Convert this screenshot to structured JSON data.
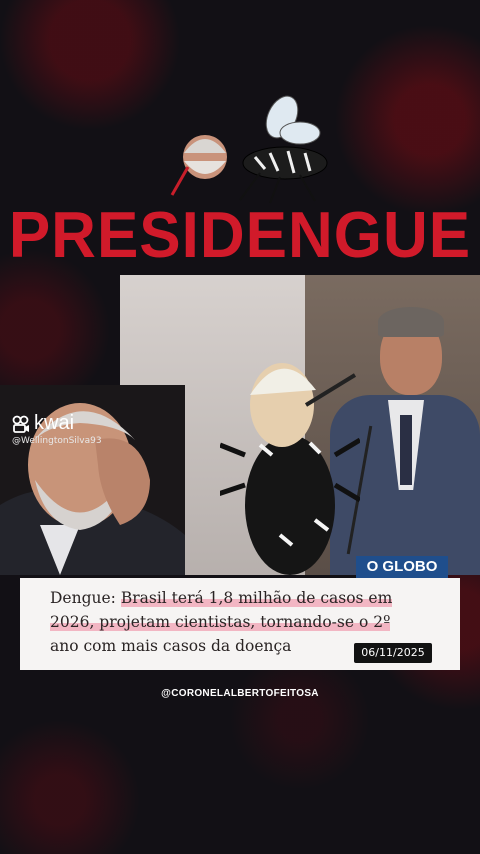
{
  "title": "PRESIDENGUE",
  "watermark": {
    "app": "kwai",
    "user": "@WellingtonSilva93"
  },
  "source_badge": "O GLOBO",
  "headline": {
    "lead": "Dengue:",
    "part1": "Brasil terá 1,8 milhão de casos em",
    "part2": "2026",
    "part3": ", projetam cientistas, tornando-se o 2º",
    "part4": "ano com mais casos da doença"
  },
  "date": "06/11/2025",
  "credit": "@CORONELALBERTOFEITOSA",
  "colors": {
    "title_red": "#d11a2a",
    "globo_blue": "#1f4e8c",
    "highlight_pink": "#f2b6c3"
  }
}
